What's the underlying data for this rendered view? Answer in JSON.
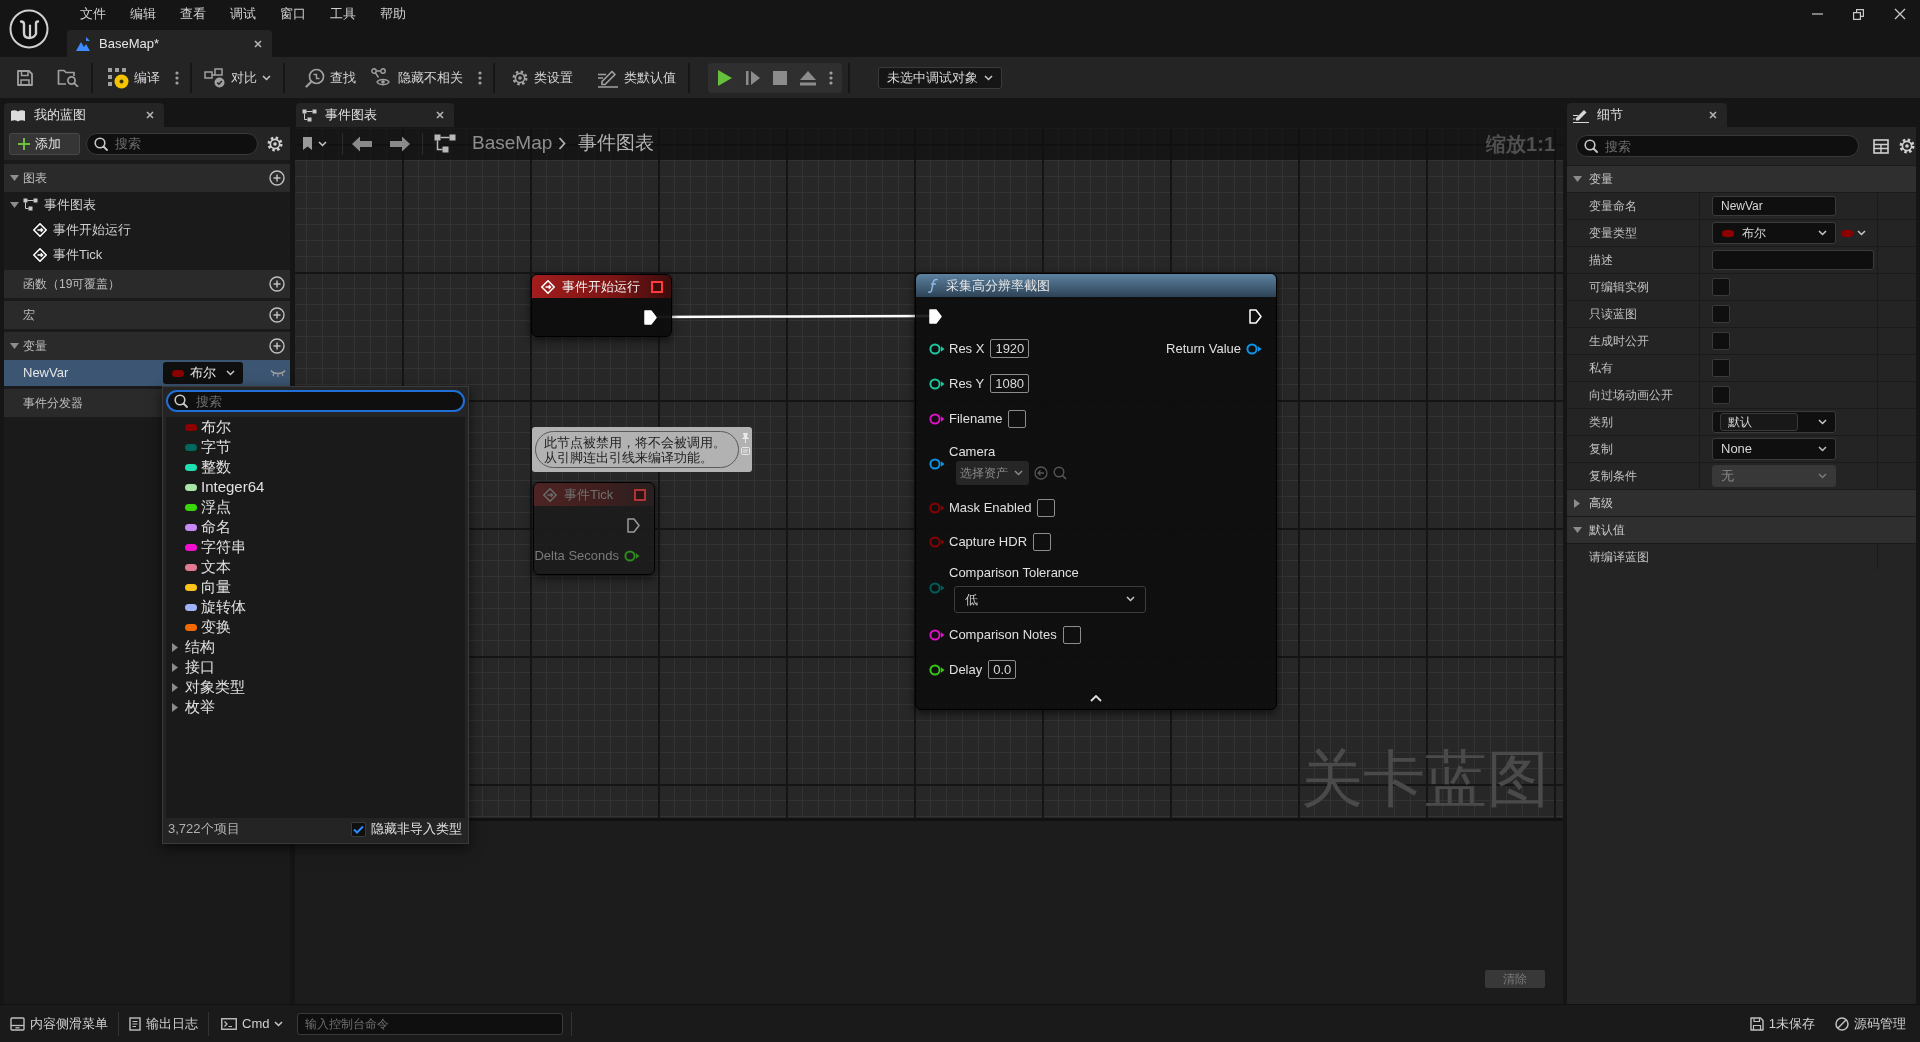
{
  "menu_bar": {
    "items": [
      "文件",
      "编辑",
      "查看",
      "调试",
      "窗口",
      "工具",
      "帮助"
    ]
  },
  "document_tabs": [
    {
      "label": "BaseMap*",
      "selected": true
    }
  ],
  "toolbar": {
    "compile": "编译",
    "diff": "对比",
    "find": "查找",
    "hide_unrelated": "隐藏不相关",
    "class_settings": "类设置",
    "class_defaults": "类默认值",
    "debug_target": "未选中调试对象"
  },
  "my_blueprint": {
    "tab": {
      "label": "我的蓝图"
    },
    "add_button": "添加",
    "search": {
      "placeholder": "搜索"
    },
    "sections": [
      {
        "title": "图表",
        "add_button": true,
        "expanded": true,
        "items": [
          {
            "label": "事件图表",
            "expanded": true,
            "children": [
              {
                "label": "事件开始运行"
              },
              {
                "label": "事件Tick"
              }
            ]
          }
        ]
      },
      {
        "title": "函数（19可覆盖）",
        "add_button": true
      },
      {
        "title": "宏",
        "add_button": true
      },
      {
        "title": "变量",
        "add_button": true,
        "expanded": true,
        "variables": [
          {
            "name": "NewVar",
            "selected": true,
            "type": {
              "label": "布尔",
              "color": "#8c0000"
            }
          }
        ]
      },
      {
        "title": "事件分发器",
        "add_button": false
      }
    ]
  },
  "type_picker": {
    "search": {
      "placeholder": "搜索"
    },
    "types": [
      {
        "label": "布尔",
        "color": "#8c0000"
      },
      {
        "label": "字节",
        "color": "#00695c"
      },
      {
        "label": "整数",
        "color": "#1fe0b0"
      },
      {
        "label": "Integer64",
        "color": "#a8e6a8"
      },
      {
        "label": "浮点",
        "color": "#3ad80a"
      },
      {
        "label": "命名",
        "color": "#c888f5"
      },
      {
        "label": "字符串",
        "color": "#f40fd0"
      },
      {
        "label": "文本",
        "color": "#e27a96"
      },
      {
        "label": "向量",
        "color": "#fcc31a"
      },
      {
        "label": "旋转体",
        "color": "#a0b2fa"
      },
      {
        "label": "变换",
        "color": "#f56a00"
      }
    ],
    "categories": [
      {
        "label": "结构",
        "expanded": false
      },
      {
        "label": "接口",
        "expanded": false
      },
      {
        "label": "对象类型",
        "expanded": false
      },
      {
        "label": "枚举",
        "expanded": false
      }
    ],
    "item_count": "3,722个项目",
    "hide_non_imported": {
      "label": "隐藏非导入类型",
      "checked": true
    }
  },
  "graph_editor": {
    "tab": {
      "label": "事件图表"
    },
    "breadcrumb": [
      "BaseMap",
      "事件图表"
    ],
    "zoom_label": "缩放1:1",
    "corner_label": "关卡蓝图",
    "nodes": [
      {
        "kind": "event",
        "title": "事件开始运行",
        "disabled": false,
        "outputs": [
          {
            "kind": "exec",
            "connected": true
          }
        ]
      },
      {
        "kind": "event",
        "title": "事件Tick",
        "disabled": true,
        "comment": "此节点被禁用，将不会被调用。从引脚连出引线来编译功能。",
        "outputs": [
          {
            "kind": "exec",
            "connected": false
          },
          {
            "kind": "data",
            "label": "Delta Seconds",
            "color": "#2e8a1e"
          }
        ]
      },
      {
        "kind": "function",
        "title": "采集高分辨率截图",
        "disabled": false,
        "inputs": [
          {
            "kind": "exec",
            "connected": true
          },
          {
            "kind": "number",
            "label": "Res X",
            "value": "1920",
            "color": "#1bc89e"
          },
          {
            "kind": "number",
            "label": "Res Y",
            "value": "1080",
            "color": "#1bc89e"
          },
          {
            "kind": "text",
            "label": "Filename",
            "color": "#e010c8"
          },
          {
            "kind": "asset",
            "label": "Camera",
            "placeholder": "选择资产",
            "color": "#0a96e8"
          },
          {
            "kind": "checkbox",
            "label": "Mask Enabled",
            "checked": false,
            "color": "#8a0000"
          },
          {
            "kind": "checkbox",
            "label": "Capture HDR",
            "checked": false,
            "color": "#8a0000"
          },
          {
            "kind": "enum",
            "label": "Comparison Tolerance",
            "value": "低",
            "color": "#005e5a"
          },
          {
            "kind": "text",
            "label": "Comparison Notes",
            "color": "#e010c8"
          },
          {
            "kind": "number",
            "label": "Delay",
            "value": "0.0",
            "color": "#35c810"
          }
        ],
        "outputs": [
          {
            "kind": "exec",
            "connected": false
          },
          {
            "kind": "data",
            "label": "Return Value",
            "color": "#0a96e8"
          }
        ]
      }
    ]
  },
  "compiler_results": {
    "clear_button": {
      "label": "清除",
      "disabled": true
    }
  },
  "details": {
    "tab": {
      "label": "细节"
    },
    "search": {
      "placeholder": "搜索"
    },
    "sections": [
      {
        "title": "变量",
        "expanded": true,
        "rows": [
          {
            "kind": "text",
            "label": "变量命名",
            "value": "NewVar",
            "disabled": false
          },
          {
            "kind": "type",
            "label": "变量类型",
            "value": "布尔",
            "color": "#8c0000",
            "disabled": false
          },
          {
            "kind": "text_wide",
            "label": "描述",
            "disabled": false
          },
          {
            "kind": "checkbox",
            "label": "可编辑实例",
            "checked": false,
            "disabled": false
          },
          {
            "kind": "checkbox",
            "label": "只读蓝图",
            "checked": false,
            "disabled": false
          },
          {
            "kind": "checkbox",
            "label": "生成时公开",
            "checked": false,
            "disabled": false
          },
          {
            "kind": "checkbox",
            "label": "私有",
            "checked": false,
            "disabled": false
          },
          {
            "kind": "checkbox",
            "label": "向过场动画公开",
            "checked": false,
            "disabled": false
          },
          {
            "kind": "combo",
            "label": "类别",
            "value": "默认",
            "disabled": false
          },
          {
            "kind": "dropdown",
            "label": "复制",
            "value": "None",
            "disabled": false
          },
          {
            "kind": "dropdown",
            "label": "复制条件",
            "value": "无",
            "disabled": true
          }
        ]
      },
      {
        "title": "高级",
        "expanded": false
      },
      {
        "title": "默认值",
        "expanded": true,
        "rows": [
          {
            "kind": "message",
            "label": "请编译蓝图"
          }
        ]
      }
    ]
  },
  "status_bar": {
    "content_drawer": "内容侧滑菜单",
    "output_log": "输出日志",
    "console_mode": "Cmd",
    "console": {
      "placeholder": "输入控制台命令"
    },
    "unsaved": "1未保存",
    "source_control": "源码管理"
  }
}
